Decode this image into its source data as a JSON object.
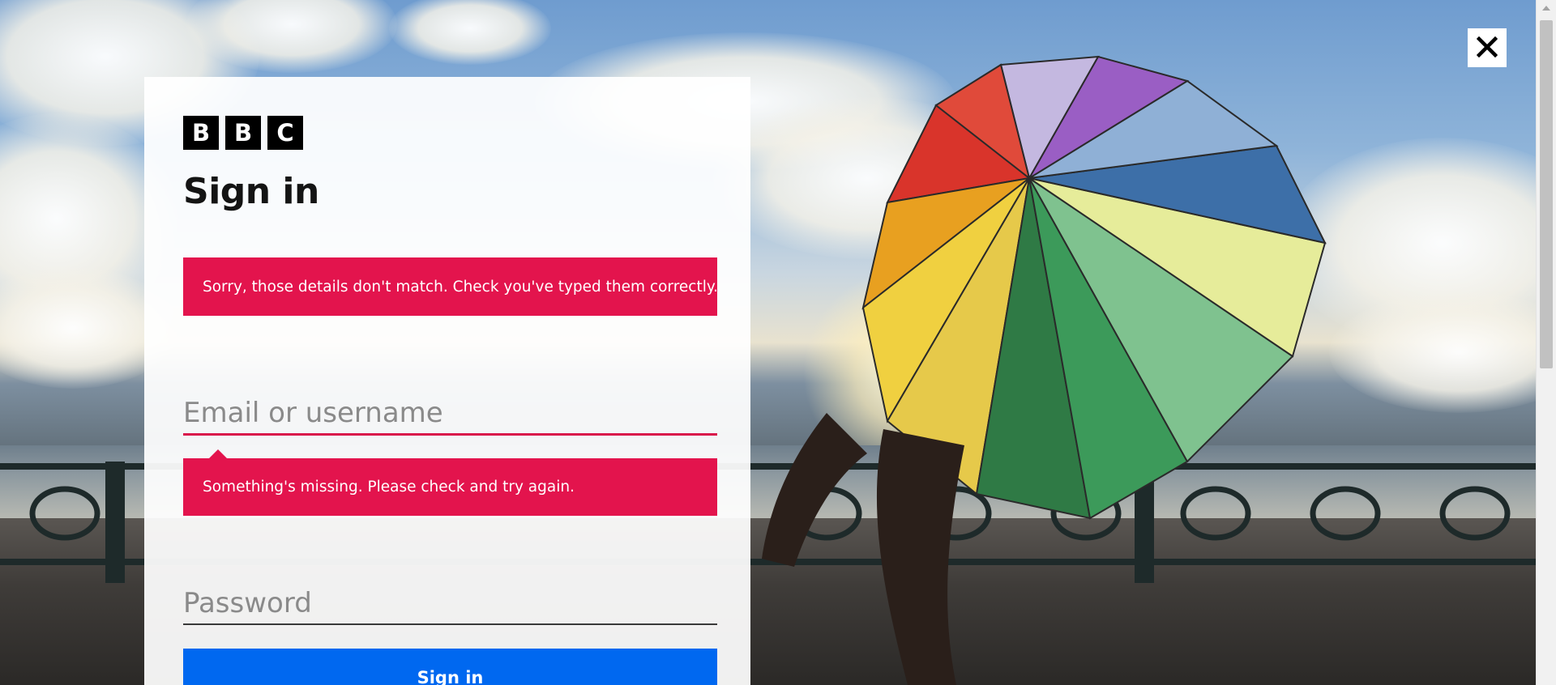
{
  "logo": {
    "letters": [
      "B",
      "B",
      "C"
    ]
  },
  "title": "Sign in",
  "error_banner": "Sorry, those details don't match. Check you've typed them correctly.",
  "email": {
    "placeholder": "Email or username",
    "value": "",
    "error": "Something's missing. Please check and try again."
  },
  "password": {
    "placeholder": "Password",
    "value": ""
  },
  "submit_label": "Sign in",
  "icons": {
    "close": "close-icon"
  },
  "colors": {
    "error": "#e3144d",
    "primary_button": "#0068f0",
    "logo_block": "#000000"
  }
}
